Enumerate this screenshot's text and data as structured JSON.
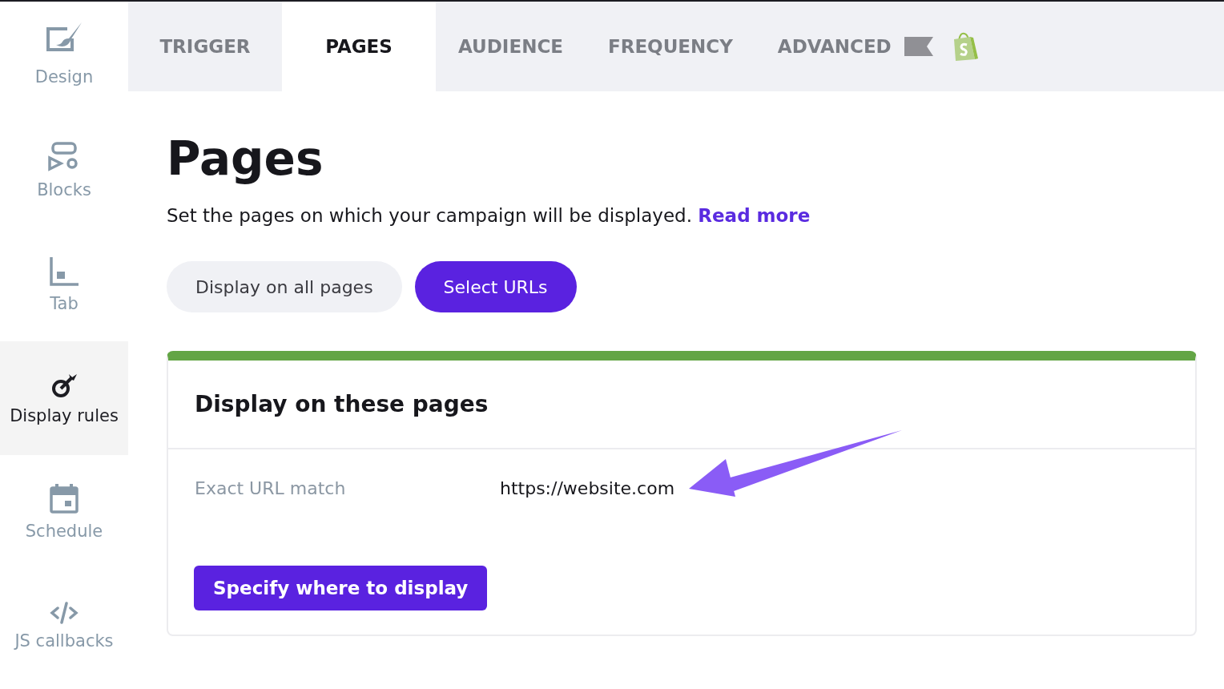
{
  "sidebar": {
    "items": [
      {
        "label": "Design",
        "selected": false
      },
      {
        "label": "Blocks",
        "selected": false
      },
      {
        "label": "Tab",
        "selected": false
      },
      {
        "label": "Display rules",
        "selected": true
      },
      {
        "label": "Schedule",
        "selected": false
      },
      {
        "label": "JS callbacks",
        "selected": false
      }
    ]
  },
  "tabs": [
    {
      "label": "TRIGGER",
      "selected": false
    },
    {
      "label": "PAGES",
      "selected": true
    },
    {
      "label": "AUDIENCE",
      "selected": false
    },
    {
      "label": "FREQUENCY",
      "selected": false
    },
    {
      "label": "ADVANCED",
      "selected": false
    }
  ],
  "page": {
    "title": "Pages",
    "description": "Set the pages on which your campaign will be displayed.",
    "read_more": "Read more"
  },
  "mode_options": [
    {
      "label": "Display on all pages",
      "selected": false
    },
    {
      "label": "Select URLs",
      "selected": true
    }
  ],
  "card": {
    "title": "Display on these pages",
    "rule_type": "Exact URL match",
    "rule_value": "https://website.com",
    "button": "Specify where to display"
  }
}
